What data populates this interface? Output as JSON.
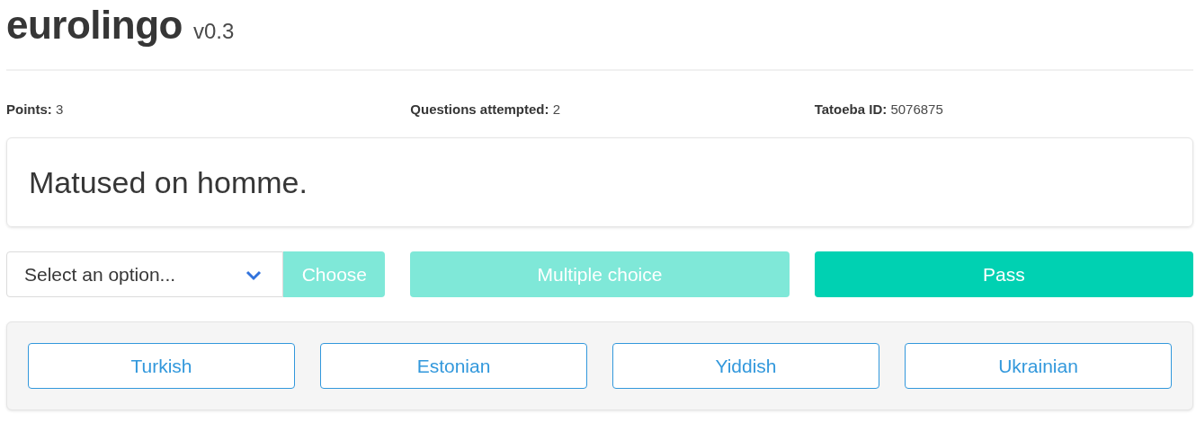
{
  "header": {
    "title": "eurolingo",
    "version": "v0.3"
  },
  "stats": [
    {
      "label": "Points:",
      "value": "3"
    },
    {
      "label": "Questions attempted:",
      "value": "2"
    },
    {
      "label": "Tatoeba ID:",
      "value": "5076875"
    }
  ],
  "sentence": "Matused on homme.",
  "select": {
    "placeholder": "Select an option..."
  },
  "buttons": [
    {
      "kind": "choose",
      "label": "Choose",
      "disabled": true
    },
    {
      "kind": "wide",
      "label": "Multiple choice",
      "disabled": true
    },
    {
      "kind": "wide",
      "label": "Pass",
      "disabled": false
    }
  ],
  "languages": [
    "Turkish",
    "Estonian",
    "Yiddish",
    "Ukrainian"
  ]
}
